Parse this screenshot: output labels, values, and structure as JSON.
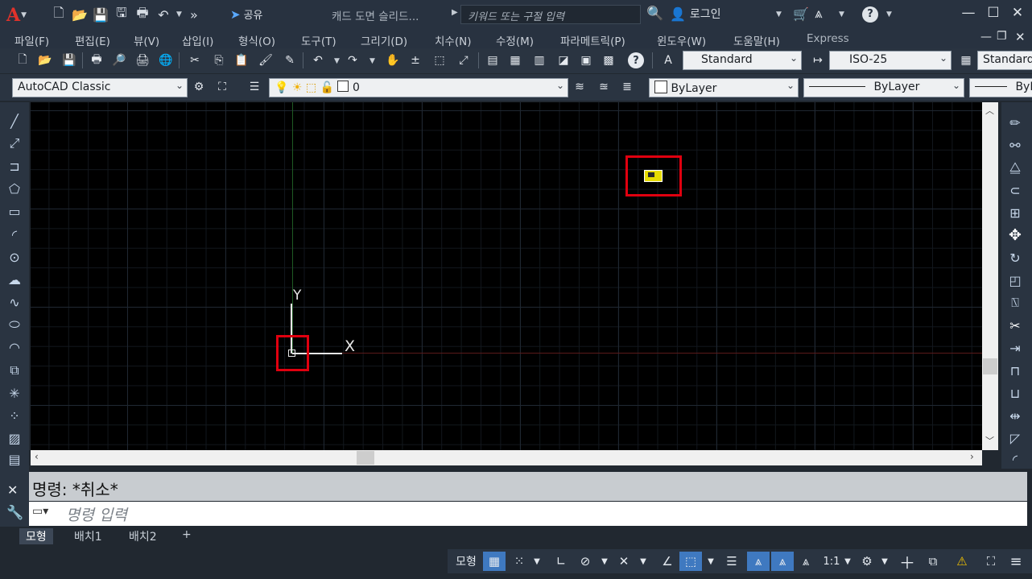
{
  "titlebar": {
    "doc_title": "캐드 도면 슬리드...",
    "share_label": "공유",
    "search_placeholder": "키워드 또는 구절 입력",
    "login_label": "로그인"
  },
  "menu": [
    "파일(F)",
    "편집(E)",
    "뷰(V)",
    "삽입(I)",
    "형식(O)",
    "도구(T)",
    "그리기(D)",
    "치수(N)",
    "수정(M)",
    "파라메트릭(P)",
    "윈도우(W)",
    "도움말(H)",
    "Express"
  ],
  "toolbar1": {
    "text_style": "Standard",
    "dim_style": "ISO-25",
    "table_style": "Standard"
  },
  "toolbar2": {
    "workspace": "AutoCAD Classic",
    "layer": "0",
    "color": "ByLayer",
    "linetype": "ByLayer",
    "lineweight": "ByL"
  },
  "ucs": {
    "x_label": "X",
    "y_label": "Y"
  },
  "command": {
    "history": "명령: *취소*",
    "placeholder": "명령 입력"
  },
  "tabs": [
    "모형",
    "배치1",
    "배치2",
    "+"
  ],
  "status": {
    "model_label": "모형",
    "scale_label": "1:1"
  },
  "colors": {
    "background": "#212830",
    "canvas": "#000000",
    "highlight": "#e0000f",
    "status_on": "#3f79c0"
  },
  "icons": {
    "left_draw": [
      "line-icon",
      "xline-icon",
      "polyline-icon",
      "polygon-icon",
      "rectangle-icon",
      "arc-icon",
      "circle-icon",
      "revcloud-icon",
      "spline-icon",
      "ellipse-icon",
      "ellipse-arc-icon",
      "insert-block-icon",
      "make-block-icon",
      "point-icon",
      "hatch-icon",
      "gradient-icon"
    ],
    "right_modify": [
      "erase-icon",
      "copy-icon",
      "mirror-icon",
      "offset-icon",
      "array-icon",
      "move-icon",
      "rotate-icon",
      "scale-icon",
      "stretch-icon",
      "trim-icon",
      "extend-icon",
      "break-at-point-icon",
      "break-icon",
      "join-icon",
      "chamfer-icon",
      "fillet-icon"
    ]
  }
}
